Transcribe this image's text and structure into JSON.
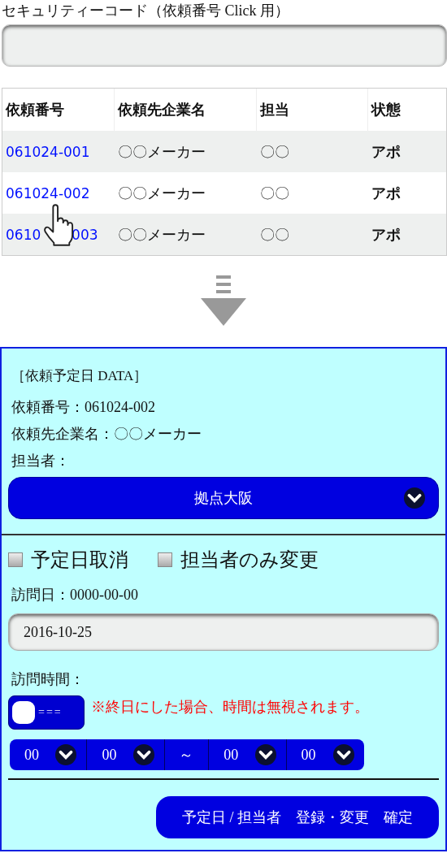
{
  "security_code": {
    "label": "セキュリティーコード（依頼番号 Click 用）"
  },
  "table": {
    "columns": [
      "依頼番号",
      "依頼先企業名",
      "担当",
      "状態"
    ],
    "rows": [
      {
        "number": "061024-001",
        "company": "〇〇メーカー",
        "person": "〇〇",
        "status": "アポ"
      },
      {
        "number": "061024-002",
        "company": "〇〇メーカー",
        "person": "〇〇",
        "status": "アポ"
      },
      {
        "number": "0610       003",
        "company": "〇〇メーカー",
        "person": "〇〇",
        "status": "アポ"
      }
    ]
  },
  "panel": {
    "heading": "［依頼予定日 DATA］",
    "info": [
      "依頼番号：061024-002",
      "依頼先企業名：〇〇メーカー",
      "担当者："
    ],
    "branch_select": "拠点大阪",
    "checkboxes": [
      {
        "label": "予定日取消",
        "checked": false
      },
      {
        "label": "担当者のみ変更",
        "checked": false
      }
    ],
    "visit_date_label": "訪問日：0000-00-00",
    "date_field": "2016-10-25",
    "visit_time_label": "訪問時間：",
    "all_day_toggle": {
      "on": false,
      "text": "==="
    },
    "note": "※終日にした場合、時間は無視されます。",
    "time_selects": [
      {
        "kind": "select",
        "value": "00"
      },
      {
        "kind": "select",
        "value": "00"
      },
      {
        "kind": "separator",
        "value": "～"
      },
      {
        "kind": "select",
        "value": "00"
      },
      {
        "kind": "select",
        "value": "00"
      }
    ],
    "submit": "予定日 / 担当者　登録・変更　確定"
  }
}
